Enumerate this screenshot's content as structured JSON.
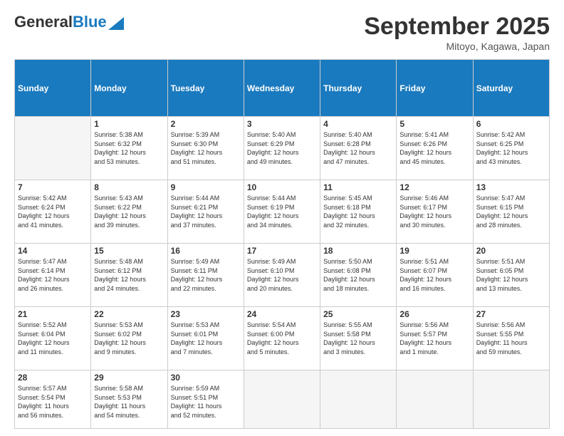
{
  "header": {
    "logo_general": "General",
    "logo_blue": "Blue",
    "month": "September 2025",
    "location": "Mitoyo, Kagawa, Japan"
  },
  "weekdays": [
    "Sunday",
    "Monday",
    "Tuesday",
    "Wednesday",
    "Thursday",
    "Friday",
    "Saturday"
  ],
  "days": [
    {
      "date": "",
      "info": ""
    },
    {
      "date": "1",
      "info": "Sunrise: 5:38 AM\nSunset: 6:32 PM\nDaylight: 12 hours\nand 53 minutes."
    },
    {
      "date": "2",
      "info": "Sunrise: 5:39 AM\nSunset: 6:30 PM\nDaylight: 12 hours\nand 51 minutes."
    },
    {
      "date": "3",
      "info": "Sunrise: 5:40 AM\nSunset: 6:29 PM\nDaylight: 12 hours\nand 49 minutes."
    },
    {
      "date": "4",
      "info": "Sunrise: 5:40 AM\nSunset: 6:28 PM\nDaylight: 12 hours\nand 47 minutes."
    },
    {
      "date": "5",
      "info": "Sunrise: 5:41 AM\nSunset: 6:26 PM\nDaylight: 12 hours\nand 45 minutes."
    },
    {
      "date": "6",
      "info": "Sunrise: 5:42 AM\nSunset: 6:25 PM\nDaylight: 12 hours\nand 43 minutes."
    },
    {
      "date": "7",
      "info": "Sunrise: 5:42 AM\nSunset: 6:24 PM\nDaylight: 12 hours\nand 41 minutes."
    },
    {
      "date": "8",
      "info": "Sunrise: 5:43 AM\nSunset: 6:22 PM\nDaylight: 12 hours\nand 39 minutes."
    },
    {
      "date": "9",
      "info": "Sunrise: 5:44 AM\nSunset: 6:21 PM\nDaylight: 12 hours\nand 37 minutes."
    },
    {
      "date": "10",
      "info": "Sunrise: 5:44 AM\nSunset: 6:19 PM\nDaylight: 12 hours\nand 34 minutes."
    },
    {
      "date": "11",
      "info": "Sunrise: 5:45 AM\nSunset: 6:18 PM\nDaylight: 12 hours\nand 32 minutes."
    },
    {
      "date": "12",
      "info": "Sunrise: 5:46 AM\nSunset: 6:17 PM\nDaylight: 12 hours\nand 30 minutes."
    },
    {
      "date": "13",
      "info": "Sunrise: 5:47 AM\nSunset: 6:15 PM\nDaylight: 12 hours\nand 28 minutes."
    },
    {
      "date": "14",
      "info": "Sunrise: 5:47 AM\nSunset: 6:14 PM\nDaylight: 12 hours\nand 26 minutes."
    },
    {
      "date": "15",
      "info": "Sunrise: 5:48 AM\nSunset: 6:12 PM\nDaylight: 12 hours\nand 24 minutes."
    },
    {
      "date": "16",
      "info": "Sunrise: 5:49 AM\nSunset: 6:11 PM\nDaylight: 12 hours\nand 22 minutes."
    },
    {
      "date": "17",
      "info": "Sunrise: 5:49 AM\nSunset: 6:10 PM\nDaylight: 12 hours\nand 20 minutes."
    },
    {
      "date": "18",
      "info": "Sunrise: 5:50 AM\nSunset: 6:08 PM\nDaylight: 12 hours\nand 18 minutes."
    },
    {
      "date": "19",
      "info": "Sunrise: 5:51 AM\nSunset: 6:07 PM\nDaylight: 12 hours\nand 16 minutes."
    },
    {
      "date": "20",
      "info": "Sunrise: 5:51 AM\nSunset: 6:05 PM\nDaylight: 12 hours\nand 13 minutes."
    },
    {
      "date": "21",
      "info": "Sunrise: 5:52 AM\nSunset: 6:04 PM\nDaylight: 12 hours\nand 11 minutes."
    },
    {
      "date": "22",
      "info": "Sunrise: 5:53 AM\nSunset: 6:02 PM\nDaylight: 12 hours\nand 9 minutes."
    },
    {
      "date": "23",
      "info": "Sunrise: 5:53 AM\nSunset: 6:01 PM\nDaylight: 12 hours\nand 7 minutes."
    },
    {
      "date": "24",
      "info": "Sunrise: 5:54 AM\nSunset: 6:00 PM\nDaylight: 12 hours\nand 5 minutes."
    },
    {
      "date": "25",
      "info": "Sunrise: 5:55 AM\nSunset: 5:58 PM\nDaylight: 12 hours\nand 3 minutes."
    },
    {
      "date": "26",
      "info": "Sunrise: 5:56 AM\nSunset: 5:57 PM\nDaylight: 12 hours\nand 1 minute."
    },
    {
      "date": "27",
      "info": "Sunrise: 5:56 AM\nSunset: 5:55 PM\nDaylight: 11 hours\nand 59 minutes."
    },
    {
      "date": "28",
      "info": "Sunrise: 5:57 AM\nSunset: 5:54 PM\nDaylight: 11 hours\nand 56 minutes."
    },
    {
      "date": "29",
      "info": "Sunrise: 5:58 AM\nSunset: 5:53 PM\nDaylight: 11 hours\nand 54 minutes."
    },
    {
      "date": "30",
      "info": "Sunrise: 5:59 AM\nSunset: 5:51 PM\nDaylight: 11 hours\nand 52 minutes."
    },
    {
      "date": "",
      "info": ""
    },
    {
      "date": "",
      "info": ""
    },
    {
      "date": "",
      "info": ""
    },
    {
      "date": "",
      "info": ""
    }
  ]
}
